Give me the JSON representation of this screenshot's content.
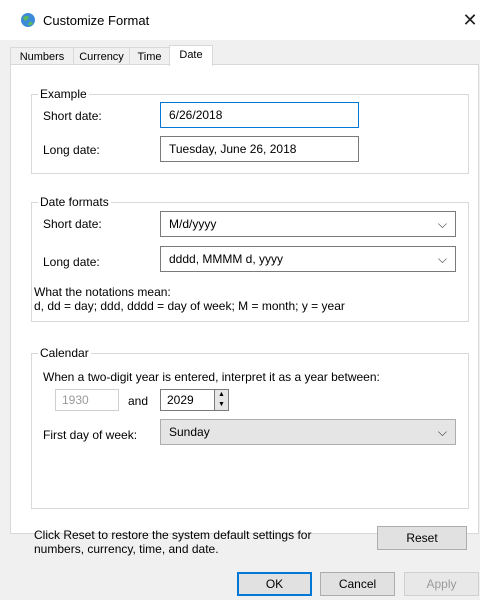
{
  "window": {
    "title": "Customize Format"
  },
  "tabs": [
    {
      "label": "Numbers"
    },
    {
      "label": "Currency"
    },
    {
      "label": "Time"
    },
    {
      "label": "Date"
    }
  ],
  "example": {
    "title": "Example",
    "short_label": "Short date:",
    "short_value": "6/26/2018",
    "long_label": "Long date:",
    "long_value": "Tuesday, June 26, 2018"
  },
  "date_formats": {
    "title": "Date formats",
    "short_label": "Short date:",
    "short_value": "M/d/yyyy",
    "long_label": "Long date:",
    "long_value": "dddd, MMMM d, yyyy",
    "notations_line1": "What the notations mean:",
    "notations_line2": "d, dd = day;  ddd, dddd = day of week;  M = month;  y = year"
  },
  "calendar": {
    "title": "Calendar",
    "instruction": "When a two-digit year is entered, interpret it as a year between:",
    "year_from": "1930",
    "and_label": "and",
    "year_to": "2029",
    "first_day_label": "First day of week:",
    "first_day_value": "Sunday"
  },
  "footer": {
    "reset_note_line1": "Click Reset to restore the system default settings for",
    "reset_note_line2": "numbers, currency, time, and date.",
    "reset_label": "Reset",
    "ok_label": "OK",
    "cancel_label": "Cancel",
    "apply_label": "Apply"
  }
}
